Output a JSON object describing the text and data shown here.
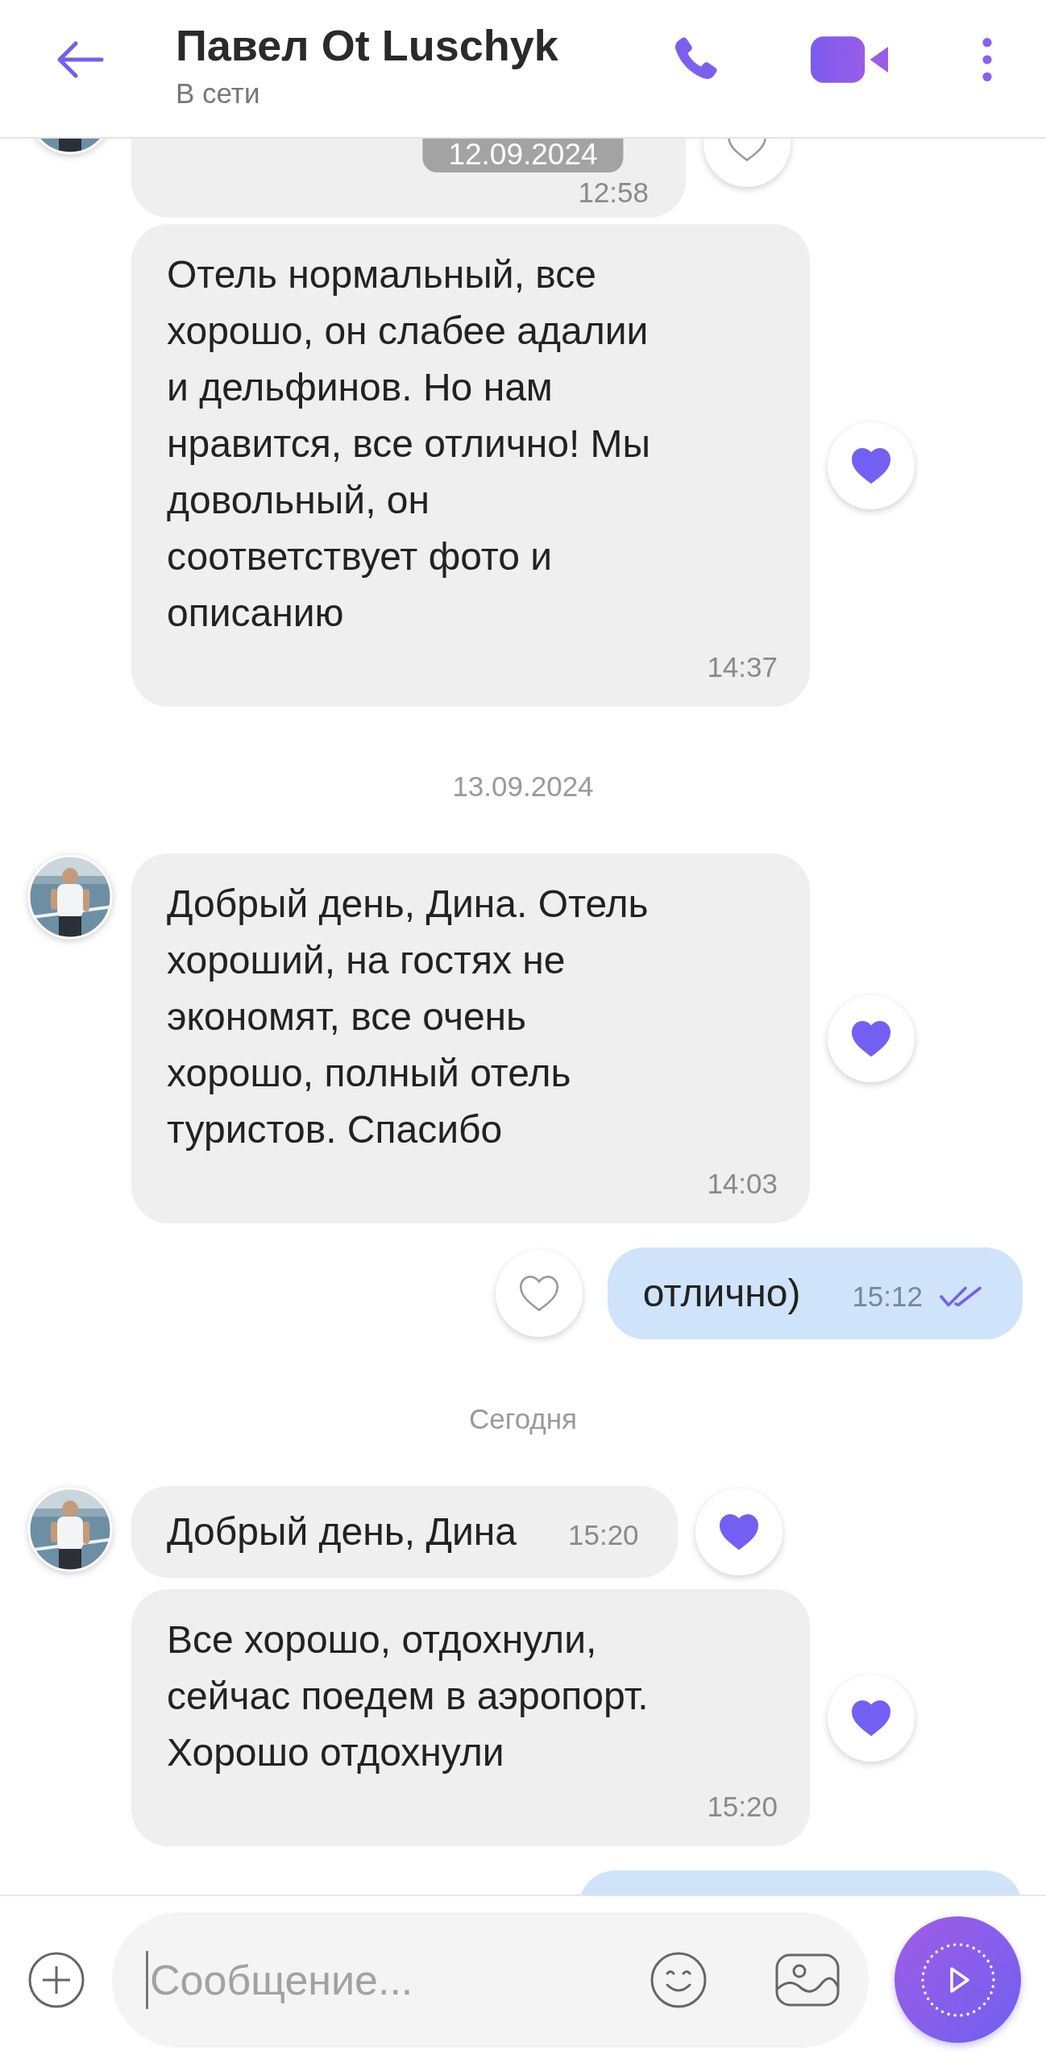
{
  "header": {
    "title": "Павел Ot Luschyk",
    "status": "В сети"
  },
  "floating_date": "12.09.2024",
  "timeline": [
    {
      "kind": "received",
      "avatar": true,
      "time": "12:58",
      "liked": false,
      "inline_time": false
    },
    {
      "kind": "received",
      "avatar": false,
      "text": "Отель нормальный, все\nхорошо, он слабее адалии\nи дельфинов. Но нам\nнравится, все отлично! Мы\nдовольный, он\nсоответствует фото и\nописанию",
      "time": "14:37",
      "liked": true,
      "inline_time": false
    },
    {
      "kind": "date",
      "text": "13.09.2024"
    },
    {
      "kind": "received",
      "avatar": true,
      "text": "Добрый день, Дина. Отель\nхороший, на гостях не\nэкономят, все очень\nхорошо, полный отель\nтуристов. Спасибо",
      "time": "14:03",
      "liked": true,
      "inline_time": false
    },
    {
      "kind": "sent",
      "text": "отлично)",
      "time": "15:12",
      "liked": false,
      "inline_time": true,
      "read": true
    },
    {
      "kind": "date",
      "text": "Сегодня"
    },
    {
      "kind": "received",
      "avatar": true,
      "text": "Добрый день, Дина",
      "time": "15:20",
      "liked": true,
      "inline_time": true
    },
    {
      "kind": "received",
      "avatar": false,
      "text": "Все хорошо, отдохнули,\nсейчас поедем в аэропорт.\nХорошо отдохнули",
      "time": "15:20",
      "liked": true,
      "inline_time": false
    },
    {
      "kind": "sent"
    }
  ],
  "composer": {
    "placeholder": "Сообщение..."
  }
}
